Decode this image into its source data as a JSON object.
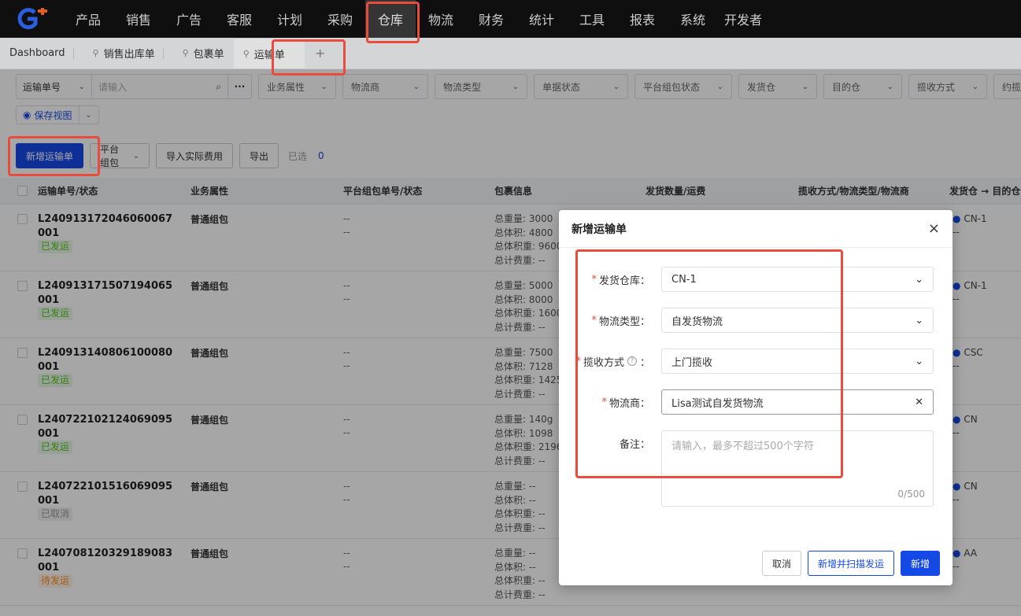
{
  "nav": {
    "items": [
      "产品",
      "销售",
      "广告",
      "客服",
      "计划",
      "采购",
      "仓库",
      "物流",
      "财务",
      "统计",
      "工具",
      "报表",
      "系统",
      "开发者"
    ],
    "active": "仓库"
  },
  "tabs": [
    {
      "label": "Dashboard",
      "pinned": false
    },
    {
      "label": "销售出库单",
      "pinned": true
    },
    {
      "label": "包裹单",
      "pinned": true
    },
    {
      "label": "运输单",
      "pinned": true,
      "active": true
    }
  ],
  "filters": {
    "search_type": "运输单号",
    "search_placeholder": "请输入",
    "more": "···",
    "selects": [
      "业务属性",
      "物流商",
      "物流类型",
      "单据状态",
      "平台组包状态",
      "发货仓",
      "目的仓",
      "揽收方式",
      "约揽"
    ],
    "save_view": "保存视图"
  },
  "toolbar": {
    "add": "新增运输单",
    "platform_pack": "平台组包",
    "import_fee": "导入实际费用",
    "export": "导出",
    "selected_label": "已选",
    "selected_count": "0"
  },
  "table": {
    "columns": [
      "运输单号/状态",
      "业务属性",
      "平台组包单号/状态",
      "包裹信息",
      "发货数量/运费",
      "揽收方式/物流类型/物流商",
      "发货仓 → 目的仓"
    ],
    "info_labels": [
      "总重量:",
      "总体积:",
      "总体积重:",
      "总计费重:"
    ],
    "rows": [
      {
        "id": "L240913172046060067001",
        "status": "已发运",
        "biz": "普通组包",
        "pkg": [
          "--",
          "--"
        ],
        "info": [
          "3000",
          "4800",
          "9600",
          "--"
        ],
        "wh": "CN-1"
      },
      {
        "id": "L240913171507194065001",
        "status": "已发运",
        "biz": "普通组包",
        "pkg": [
          "--",
          "--"
        ],
        "info": [
          "5000",
          "8000",
          "1600",
          "--"
        ],
        "wh": "CN-1"
      },
      {
        "id": "L240913140806100080001",
        "status": "已发运",
        "biz": "普通组包",
        "pkg": [
          "--",
          "--"
        ],
        "info": [
          "7500",
          "7128",
          "1425",
          "--"
        ],
        "wh": "CSC"
      },
      {
        "id": "L240722102124069095001",
        "status": "已发运",
        "biz": "普通组包",
        "pkg": [
          "--",
          "--"
        ],
        "info": [
          "140g",
          "1098",
          "2196",
          "--"
        ],
        "wh": "CN"
      },
      {
        "id": "L240722101516069095001",
        "status": "已取消",
        "biz": "普通组包",
        "pkg": [
          "--",
          "--"
        ],
        "info": [
          "--",
          "--",
          "--",
          "--"
        ],
        "wh": "CN"
      },
      {
        "id": "L240708120329189083001",
        "status": "待发运",
        "biz": "普通组包",
        "pkg": [
          "--",
          "--"
        ],
        "info": [
          "--",
          "--",
          "--",
          "--"
        ],
        "wh": "AA"
      }
    ]
  },
  "modal": {
    "title": "新增运输单",
    "fields": [
      {
        "label": "发货仓库",
        "required": true,
        "value": "CN-1",
        "control": "select"
      },
      {
        "label": "物流类型",
        "required": true,
        "value": "自发货物流",
        "control": "select"
      },
      {
        "label": "揽收方式",
        "required": true,
        "value": "上门揽收",
        "control": "select",
        "help": true
      },
      {
        "label": "物流商",
        "required": true,
        "value": "Lisa测试自发货物流",
        "control": "clearable"
      }
    ],
    "remark_label": "备注",
    "remark_placeholder": "请输入，最多不超过500个字符",
    "remark_counter": "0/500",
    "cancel": "取消",
    "add_and_scan": "新增并扫描发运",
    "confirm": "新增"
  },
  "colors": {
    "primary": "#1549e6",
    "highlight": "#e74c3c",
    "shipped": "#52c41a",
    "pending": "#fa8c16",
    "cancelled": "#999999"
  }
}
